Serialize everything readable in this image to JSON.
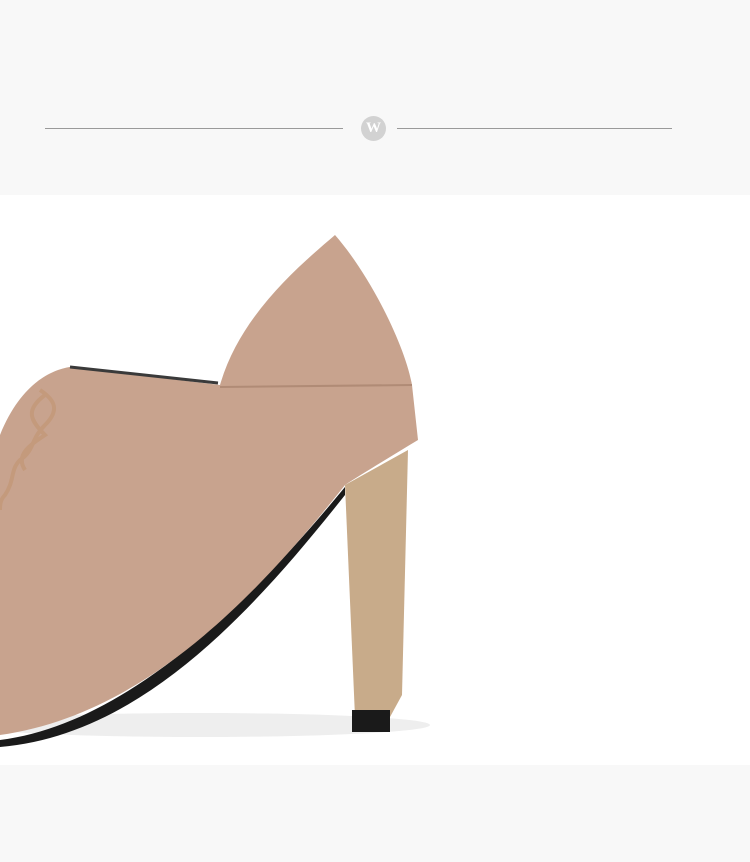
{
  "header": {
    "logo_letter": "W"
  },
  "product_photo": {
    "subject": "suede-high-heel-bootie",
    "colors": {
      "suede": "#c8a38e",
      "heel": "#c8ab8a",
      "sole": "#1a1a1a",
      "top_band": "#f8f8f8"
    }
  }
}
